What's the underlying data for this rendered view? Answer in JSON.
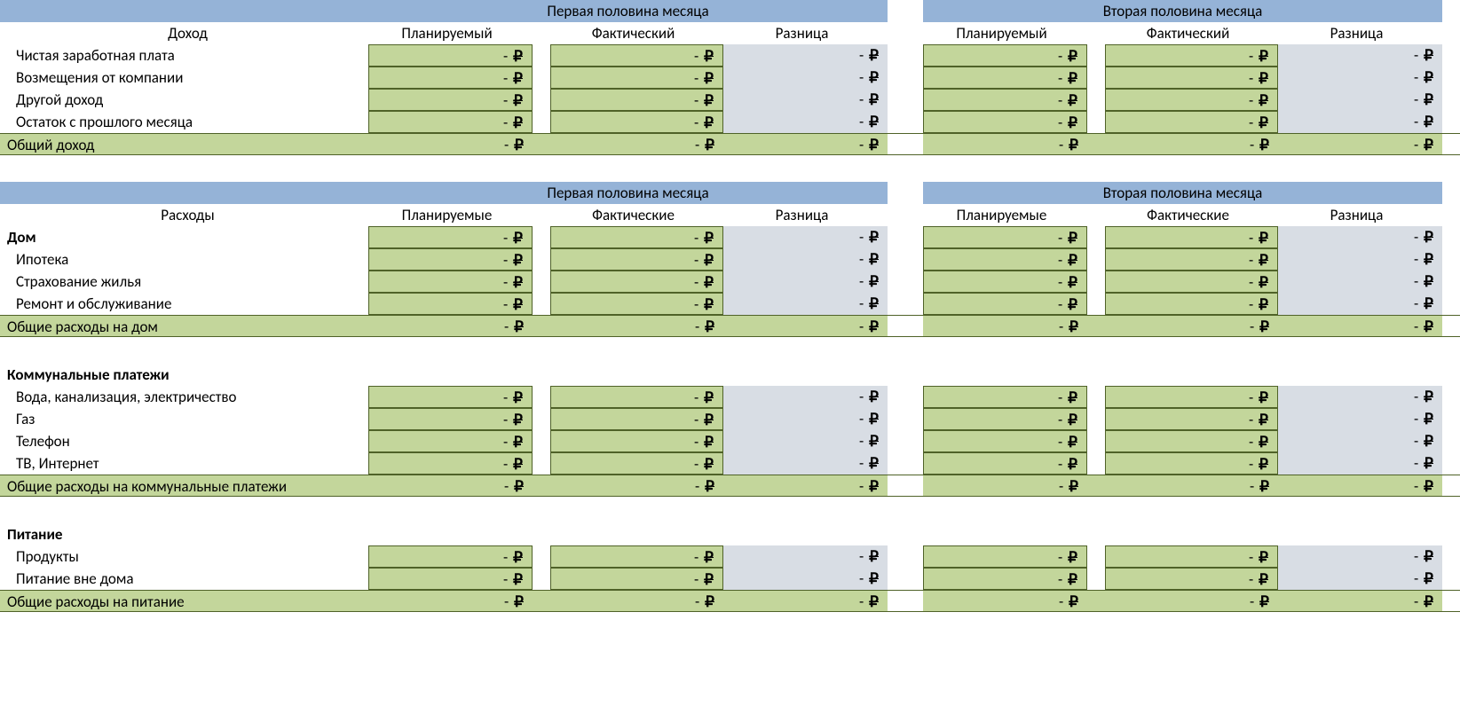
{
  "currency": "₽",
  "dash": "-",
  "headers": {
    "first_half": "Первая половина месяца",
    "second_half": "Вторая половина месяца",
    "planned_m": "Планируемый",
    "actual_m": "Фактический",
    "planned_pl": "Планируемые",
    "actual_pl": "Фактические",
    "diff": "Разница"
  },
  "income": {
    "title": "Доход",
    "rows": [
      "Чистая заработная плата",
      "Возмещения от компании",
      "Другой доход",
      "Остаток с прошлого месяца"
    ],
    "total": "Общий доход"
  },
  "expenses": {
    "title": "Расходы",
    "groups": [
      {
        "name": "Дом",
        "has_header_values": true,
        "rows": [
          "Ипотека",
          "Страхование жилья",
          "Ремонт и обслуживание"
        ],
        "total": "Общие расходы на дом"
      },
      {
        "name": "Коммунальные платежи",
        "has_header_values": false,
        "rows": [
          "Вода, канализация, электричество",
          "Газ",
          "Телефон",
          "ТВ, Интернет"
        ],
        "total": "Общие расходы на коммунальные платежи"
      },
      {
        "name": "Питание",
        "has_header_values": false,
        "rows": [
          "Продукты",
          "Питание вне дома"
        ],
        "total": "Общие расходы на питание"
      }
    ]
  }
}
